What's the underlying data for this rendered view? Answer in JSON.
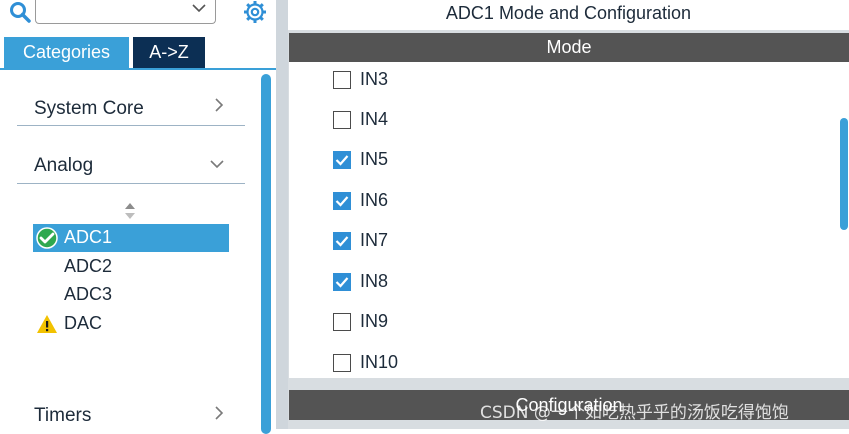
{
  "toolbar": {
    "search_value": "",
    "icons": [
      "search-icon",
      "chevron-down-icon",
      "gear-icon"
    ]
  },
  "tabs": {
    "categories": "Categories",
    "az": "A->Z"
  },
  "tree": {
    "categories": [
      {
        "label": "System Core",
        "expanded": false
      },
      {
        "label": "Analog",
        "expanded": true
      },
      {
        "label": "Timers",
        "expanded": false
      }
    ],
    "analog_items": [
      {
        "label": "ADC1",
        "status": "ok",
        "selected": true
      },
      {
        "label": "ADC2",
        "status": "",
        "selected": false
      },
      {
        "label": "ADC3",
        "status": "",
        "selected": false
      },
      {
        "label": "DAC",
        "status": "warning",
        "selected": false
      }
    ]
  },
  "main": {
    "title": "ADC1 Mode and Configuration",
    "mode_header": "Mode",
    "channels": [
      {
        "label": "IN3",
        "checked": false
      },
      {
        "label": "IN4",
        "checked": false
      },
      {
        "label": "IN5",
        "checked": true
      },
      {
        "label": "IN6",
        "checked": true
      },
      {
        "label": "IN7",
        "checked": true
      },
      {
        "label": "IN8",
        "checked": true
      },
      {
        "label": "IN9",
        "checked": false
      },
      {
        "label": "IN10",
        "checked": false
      }
    ],
    "config_header": "Configuration"
  },
  "watermark": "CSDN @一个如吃热乎乎的汤饭吃得饱饱",
  "colors": {
    "accent": "#3aa0d8",
    "tab_dark": "#0c2f54",
    "header_gray": "#545454",
    "ok_green": "#2fa84f",
    "warn_yellow": "#f2c200"
  }
}
